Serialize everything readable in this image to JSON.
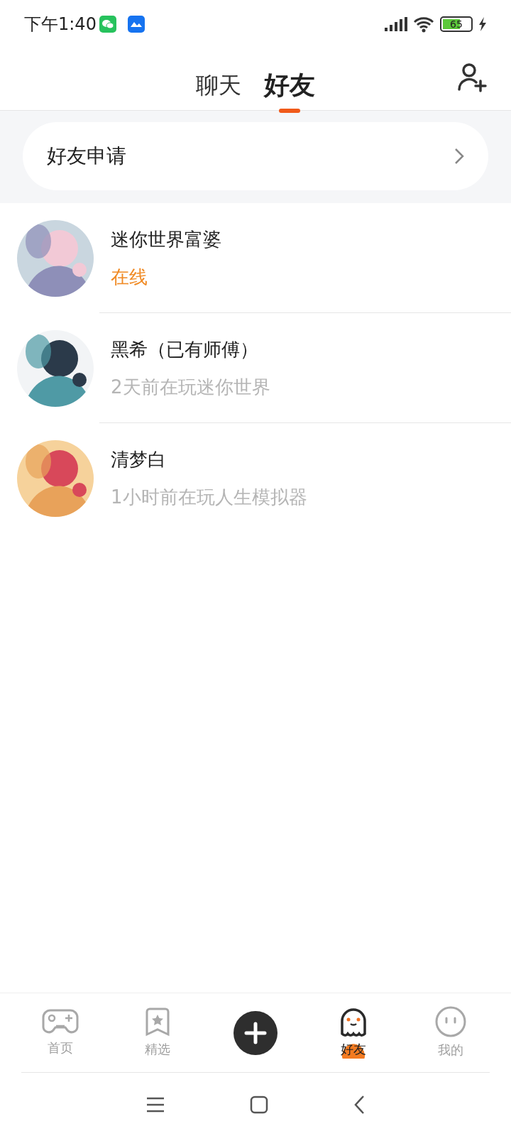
{
  "status_bar": {
    "time": "下午1:40",
    "battery": "65"
  },
  "tabs": [
    {
      "label": "聊天",
      "selected": false
    },
    {
      "label": "好友",
      "selected": true
    }
  ],
  "friend_request": {
    "label": "好友申请"
  },
  "friends": [
    {
      "name": "迷你世界富婆",
      "status": "在线",
      "online": true,
      "kind": "picture"
    },
    {
      "name": "黑希（已有师傅）",
      "status": "2天前在玩迷你世界",
      "online": false,
      "kind": "picture"
    },
    {
      "name": "清梦白",
      "status": "1小时前在玩人生模拟器",
      "online": false,
      "kind": "picture"
    }
  ],
  "bottom_nav": [
    {
      "kind": "tab",
      "label": "首页",
      "selected": false
    },
    {
      "kind": "tab",
      "label": "精选",
      "selected": false
    },
    {
      "kind": "add"
    },
    {
      "kind": "tab",
      "label": "好友",
      "selected": true
    },
    {
      "kind": "tab",
      "label": "我的",
      "selected": false
    }
  ]
}
